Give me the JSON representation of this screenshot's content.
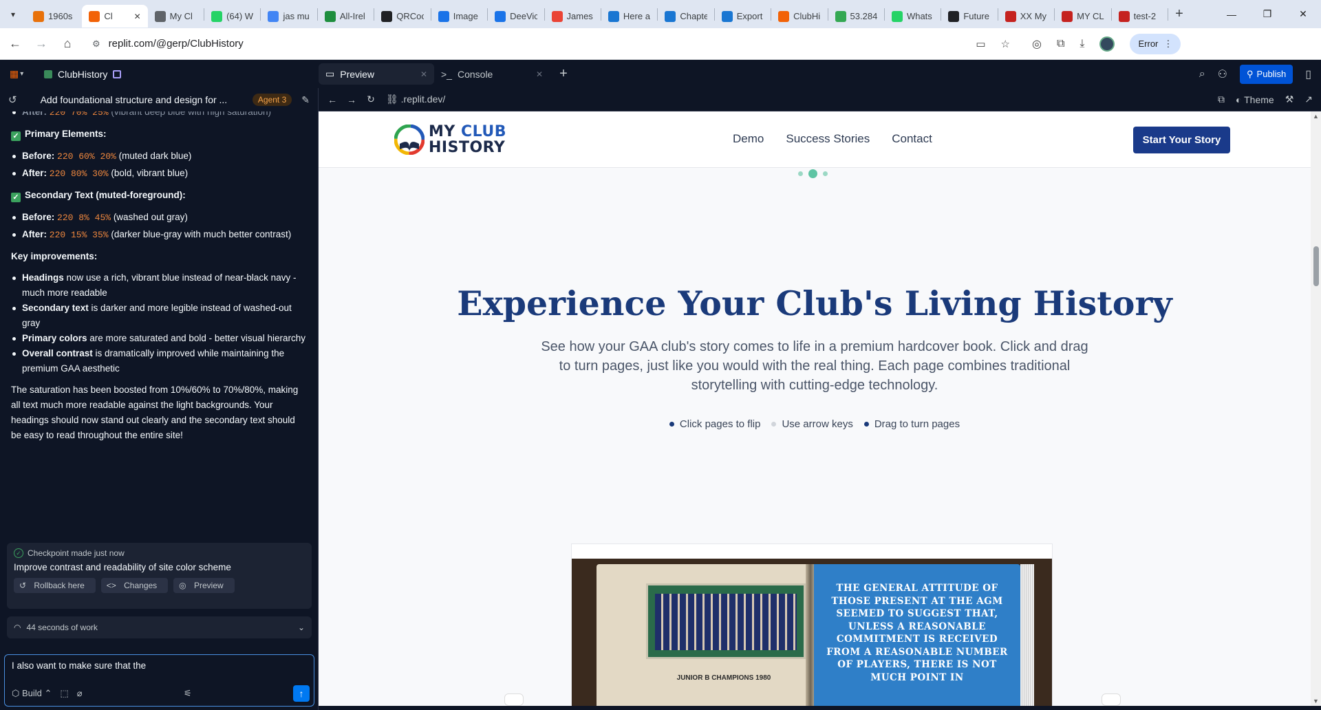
{
  "browser": {
    "tabs": [
      {
        "title": "1960s",
        "fav_color": "#e8710a",
        "active": false
      },
      {
        "title": "Cl",
        "fav_color": "#f26207",
        "active": true
      },
      {
        "title": "My Cl",
        "fav_color": "#5f6368",
        "active": false
      },
      {
        "title": "(64) W",
        "fav_color": "#25d366",
        "active": false
      },
      {
        "title": "jas mu",
        "fav_color": "#4285f4",
        "active": false
      },
      {
        "title": "All-Irel",
        "fav_color": "#1e8e3e",
        "active": false
      },
      {
        "title": "QRCoc",
        "fav_color": "#202124",
        "active": false
      },
      {
        "title": "Image",
        "fav_color": "#1a73e8",
        "active": false
      },
      {
        "title": "DeeVic",
        "fav_color": "#1a73e8",
        "active": false
      },
      {
        "title": "James",
        "fav_color": "#ea4335",
        "active": false
      },
      {
        "title": "Here a",
        "fav_color": "#1976d2",
        "active": false
      },
      {
        "title": "Chapte",
        "fav_color": "#1976d2",
        "active": false
      },
      {
        "title": "Export",
        "fav_color": "#1976d2",
        "active": false
      },
      {
        "title": "ClubHi",
        "fav_color": "#f26207",
        "active": false
      },
      {
        "title": "53.284",
        "fav_color": "#34a853",
        "active": false
      },
      {
        "title": "Whats",
        "fav_color": "#25d366",
        "active": false
      },
      {
        "title": "Future",
        "fav_color": "#202124",
        "active": false
      },
      {
        "title": "XX My",
        "fav_color": "#c5221f",
        "active": false
      },
      {
        "title": "MY CL",
        "fav_color": "#c5221f",
        "active": false
      },
      {
        "title": "test-2",
        "fav_color": "#c5221f",
        "active": false
      }
    ],
    "url": "replit.com/@gerp/ClubHistory",
    "error_label": "Error"
  },
  "replit": {
    "project_name": "ClubHistory",
    "tabs": [
      {
        "label": "Preview",
        "icon": "monitor-icon"
      },
      {
        "label": "Console",
        "icon": "terminal-icon"
      }
    ],
    "publish_label": "Publish",
    "preview_url": ".replit.dev/",
    "theme_label": "Theme"
  },
  "chat": {
    "thread_title": "Add foundational structure and design for ...",
    "agent_badge": "Agent 3",
    "top_cut": {
      "label": "After:",
      "code": "220 70% 25%",
      "text": "(vibrant deep blue with high saturation)"
    },
    "primary_heading": "Primary Elements:",
    "primary_before": {
      "label": "Before:",
      "code": "220 60% 20%",
      "text": "(muted dark blue)"
    },
    "primary_after": {
      "label": "After:",
      "code": "220 80% 30%",
      "text": "(bold, vibrant blue)"
    },
    "secondary_heading": "Secondary Text (muted-foreground):",
    "secondary_before": {
      "label": "Before:",
      "code": "220 8% 45%",
      "text": "(washed out gray)"
    },
    "secondary_after": {
      "label": "After:",
      "code": "220 15% 35%",
      "text": "(darker blue-gray with much better contrast)"
    },
    "key_heading": "Key improvements:",
    "improvements": [
      {
        "bold": "Headings",
        "text": " now use a rich, vibrant blue instead of near-black navy - much more readable"
      },
      {
        "bold": "Secondary text",
        "text": " is darker and more legible instead of washed-out gray"
      },
      {
        "bold": "Primary colors",
        "text": " are more saturated and bold - better visual hierarchy"
      },
      {
        "bold": "Overall contrast",
        "text": " is dramatically improved while maintaining the premium GAA aesthetic"
      }
    ],
    "summary": "The saturation has been boosted from 10%/60% to 70%/80%, making all text much more readable against the light backgrounds. Your headings should now stand out clearly and the secondary text should be easy to read throughout the entire site!",
    "checkpoint": {
      "title": "Checkpoint made just now",
      "message": "Improve contrast and readability of site color scheme",
      "buttons": [
        "Rollback here",
        "Changes",
        "Preview"
      ]
    },
    "work_label": "44 seconds of work",
    "input_value": "I also want to make sure that the ",
    "build_label": "Build"
  },
  "site": {
    "logo_line1_a": "MY ",
    "logo_line1_b": "CLUB",
    "logo_line2": "HISTORY",
    "nav_links": [
      "Demo",
      "Success Stories",
      "Contact"
    ],
    "cta_label": "Start Your Story",
    "hero_title": "Experience Your Club's Living History",
    "hero_subtitle": "See how your GAA club's story comes to life in a premium hardcover book. Click and drag to turn pages, just like you would with the real thing. Each page combines traditional storytelling with cutting-edge technology.",
    "features": [
      "Click pages to flip",
      "Use arrow keys",
      "Drag to turn pages"
    ],
    "book_caption": "JUNIOR B CHAMPIONS 1980",
    "book_quote": "THE GENERAL ATTITUDE OF THOSE PRESENT AT THE AGM SEEMED TO SUGGEST THAT, UNLESS A REASONABLE COMMITMENT IS RECEIVED FROM A REASONABLE NUMBER OF PLAYERS, THERE IS NOT MUCH POINT IN"
  }
}
